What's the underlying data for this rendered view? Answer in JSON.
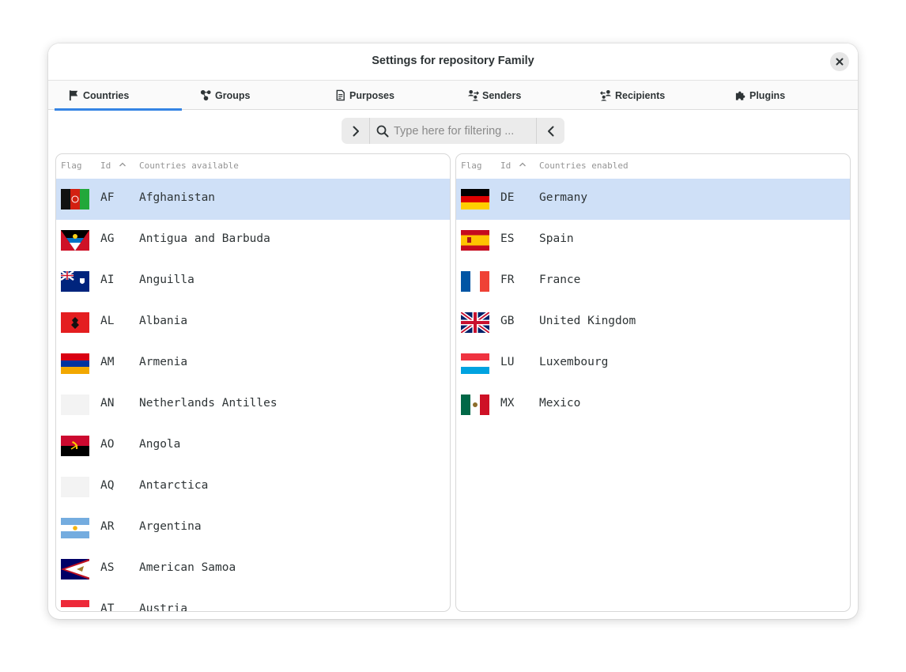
{
  "window": {
    "title": "Settings for repository Family"
  },
  "tabs": [
    {
      "label": "Countries",
      "icon": "flag-icon",
      "active": true
    },
    {
      "label": "Groups",
      "icon": "groups-icon",
      "active": false
    },
    {
      "label": "Purposes",
      "icon": "document-icon",
      "active": false
    },
    {
      "label": "Senders",
      "icon": "senders-icon",
      "active": false
    },
    {
      "label": "Recipients",
      "icon": "recipients-icon",
      "active": false
    },
    {
      "label": "Plugins",
      "icon": "puzzle-icon",
      "active": false
    }
  ],
  "filter": {
    "placeholder": "Type here for filtering ..."
  },
  "available": {
    "columns": {
      "flag": "Flag",
      "id": "Id",
      "name": "Countries available"
    },
    "rows": [
      {
        "id": "AF",
        "name": "Afghanistan",
        "selected": true
      },
      {
        "id": "AG",
        "name": "Antigua and Barbuda"
      },
      {
        "id": "AI",
        "name": "Anguilla"
      },
      {
        "id": "AL",
        "name": "Albania"
      },
      {
        "id": "AM",
        "name": "Armenia"
      },
      {
        "id": "AN",
        "name": "Netherlands Antilles"
      },
      {
        "id": "AO",
        "name": "Angola"
      },
      {
        "id": "AQ",
        "name": "Antarctica"
      },
      {
        "id": "AR",
        "name": "Argentina"
      },
      {
        "id": "AS",
        "name": "American Samoa"
      },
      {
        "id": "AT",
        "name": "Austria"
      }
    ]
  },
  "enabled": {
    "columns": {
      "flag": "Flag",
      "id": "Id",
      "name": "Countries enabled"
    },
    "rows": [
      {
        "id": "DE",
        "name": "Germany",
        "selected": true
      },
      {
        "id": "ES",
        "name": "Spain"
      },
      {
        "id": "FR",
        "name": "France"
      },
      {
        "id": "GB",
        "name": "United Kingdom"
      },
      {
        "id": "LU",
        "name": "Luxembourg"
      },
      {
        "id": "MX",
        "name": "Mexico"
      }
    ]
  },
  "colors": {
    "accent": "#3584e4",
    "selected_row": "#cfe0f7"
  }
}
